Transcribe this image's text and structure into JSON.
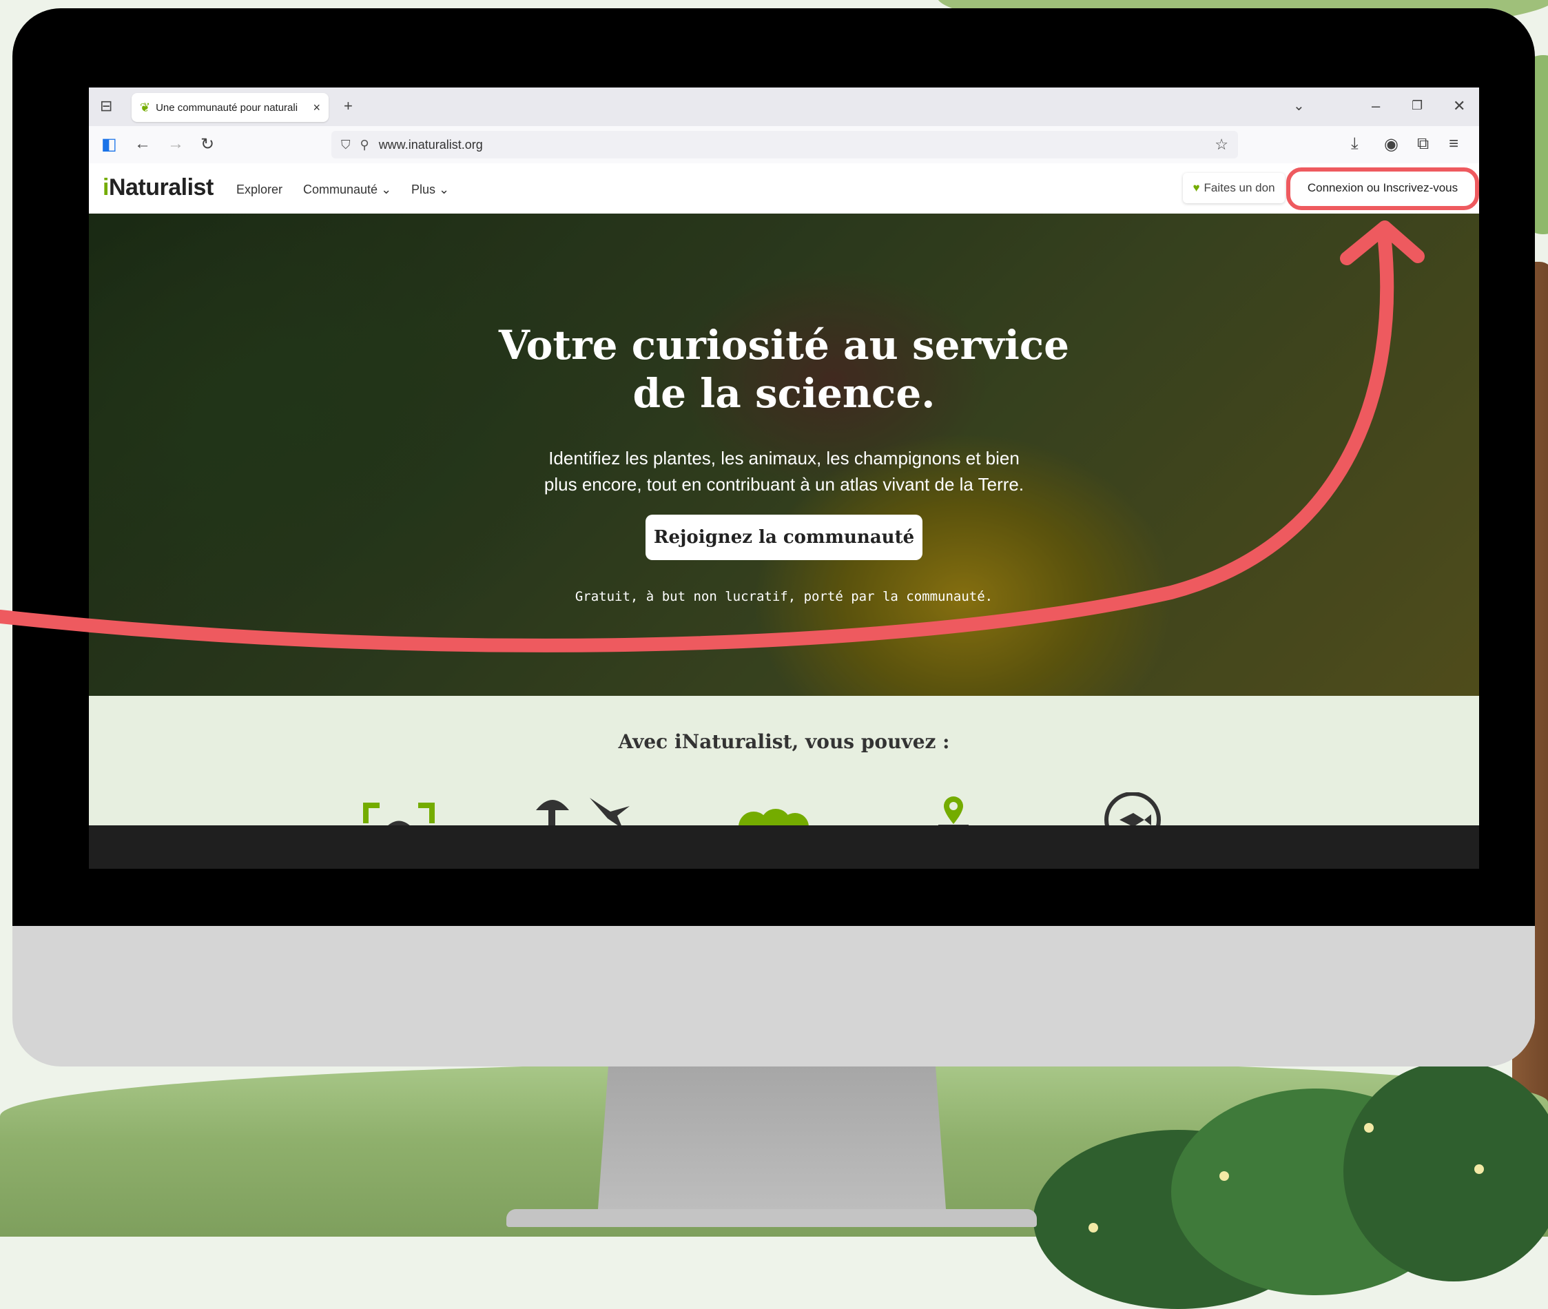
{
  "browser": {
    "tab_title": "Une communauté pour naturali",
    "url": "www.inaturalist.org"
  },
  "site": {
    "logo_i": "i",
    "logo_rest": "Naturalist",
    "menu": {
      "explore": "Explorer",
      "community": "Communauté",
      "more": "Plus"
    },
    "donate_label": "Faites un don",
    "signin_label": "Connexion ou Inscrivez-vous"
  },
  "hero": {
    "title_line1": "Votre curiosité au service",
    "title_line2": "de la science.",
    "subtitle_line1": "Identifiez les plantes, les animaux, les champignons et bien",
    "subtitle_line2": "plus encore, tout en contribuant à un atlas vivant de la Terre.",
    "cta_label": "Rejoignez la communauté",
    "note": "Gratuit, à but non lucratif, porté par la communauté."
  },
  "features": {
    "title": "Avec iNaturalist, vous pouvez :"
  },
  "colors": {
    "brand_green": "#74ac00",
    "highlight_red": "#ee5a5f"
  },
  "icons": [
    "tab-overview-icon",
    "leaf-favicon",
    "close-icon",
    "new-tab-icon",
    "chevron-down-icon",
    "minimize-icon",
    "restore-icon",
    "window-close-icon",
    "sidebar-icon",
    "back-icon",
    "forward-icon",
    "reload-icon",
    "shield-icon",
    "permissions-icon",
    "bookmark-star-icon",
    "download-icon",
    "account-icon",
    "extensions-icon",
    "menu-icon",
    "heart-icon"
  ]
}
